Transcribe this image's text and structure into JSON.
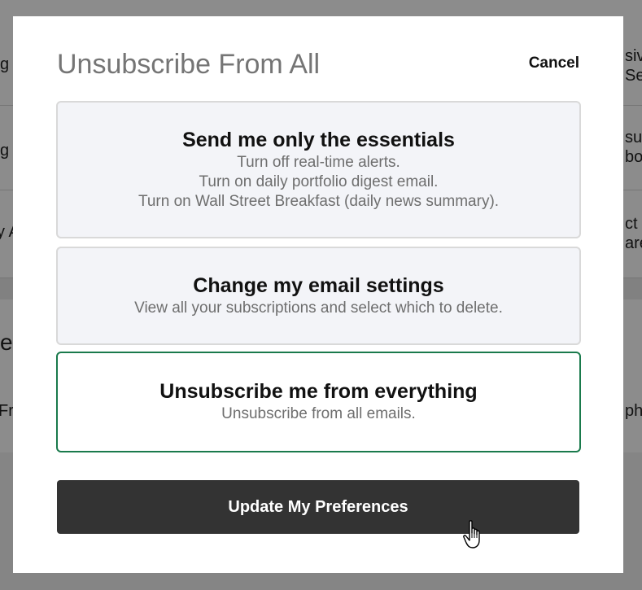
{
  "background": {
    "left_fragments": [
      "g",
      "g",
      "y A",
      "e",
      "Fr"
    ],
    "right_fragments": [
      "siv",
      "Se",
      "sul",
      "bo",
      "ct n",
      "are",
      "ph"
    ]
  },
  "modal": {
    "title": "Unsubscribe From All",
    "cancel_label": "Cancel",
    "options": [
      {
        "title": "Send me only the essentials",
        "lines": [
          "Turn off real-time alerts.",
          "Turn on daily portfolio digest email.",
          "Turn on Wall Street Breakfast (daily news summary)."
        ],
        "selected": false
      },
      {
        "title": "Change my email settings",
        "lines": [
          "View all your subscriptions and select which to delete."
        ],
        "selected": false
      },
      {
        "title": "Unsubscribe me from everything",
        "lines": [
          "Unsubscribe from all emails."
        ],
        "selected": true
      }
    ],
    "update_label": "Update My Preferences"
  },
  "colors": {
    "selected_border": "#1a7a4c",
    "button_bg": "#333333",
    "option_bg": "#f3f4f8"
  },
  "icons": {
    "cursor": "hand-pointer-icon"
  }
}
